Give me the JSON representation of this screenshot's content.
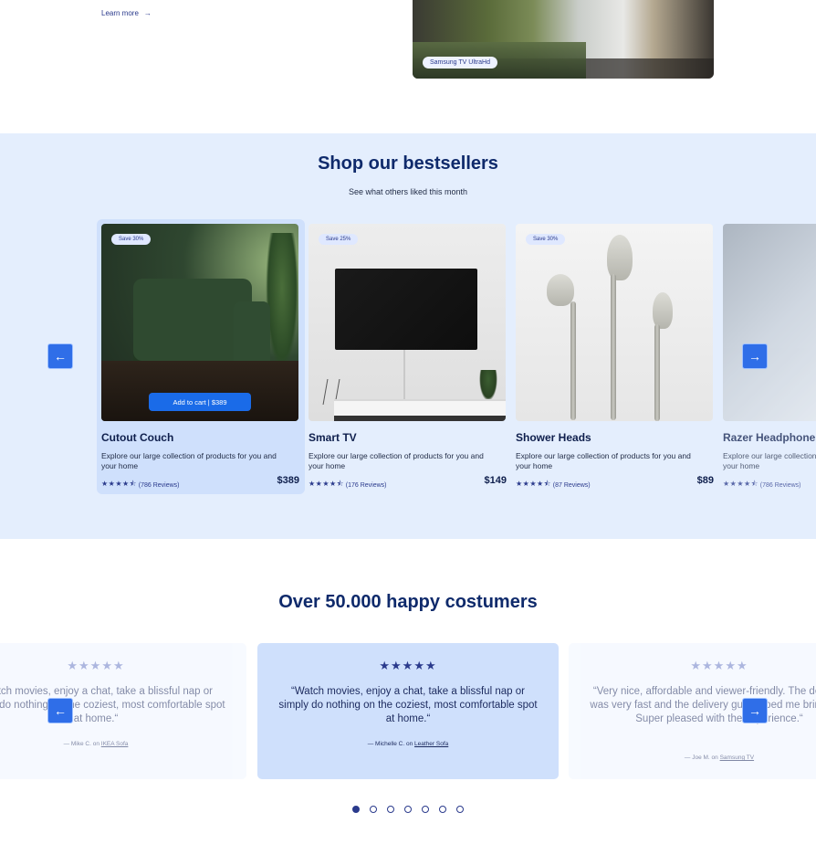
{
  "hero": {
    "learn_more": "Learn more",
    "image_tag": "Samsung TV UltraHd"
  },
  "bestsellers": {
    "title": "Shop our bestsellers",
    "subtitle": "See what others liked this month",
    "add_to_cart": "Add to cart | $389",
    "products": [
      {
        "badge": "Save 30%",
        "name": "Cutout Couch",
        "description": "Explore our large collection of products for you and your home",
        "rating": 4.5,
        "reviews": "(786 Reviews)",
        "price": "$389"
      },
      {
        "badge": "Save 25%",
        "name": "Smart TV",
        "description": "Explore our large collection of products for you and your home",
        "rating": 4.5,
        "reviews": "(176 Reviews)",
        "price": "$149"
      },
      {
        "badge": "Save 30%",
        "name": "Shower Heads",
        "description": "Explore our large collection of products for you and your home",
        "rating": 4.5,
        "reviews": "(87 Reviews)",
        "price": "$89"
      },
      {
        "badge": "",
        "name": "Razer Headphone",
        "description": "Explore our large collection of products for you and your home",
        "rating": 4.5,
        "reviews": "(786 Reviews)",
        "price": ""
      }
    ]
  },
  "testimonials": {
    "title": "Over 50.000 happy costumers",
    "reviews": [
      {
        "quote": "“Watch movies, enjoy a chat, take a blissful nap or simply do nothing on the coziest, most comfortable spot at home.“",
        "author": "— Mike C. on",
        "product": "IKEA Sofa"
      },
      {
        "quote": "“Watch movies, enjoy a chat, take a blissful nap or simply do nothing on the coziest, most comfortable spot at home.“",
        "author": "— Michelle C. on",
        "product": "Leather Sofa"
      },
      {
        "quote": "“Very nice, affordable and viewer-friendly. The delivery was very fast and the delivery guy helped me bring it in. Super pleased with the experience.“",
        "author": "— Joe M. on",
        "product": "Samsung TV"
      }
    ],
    "dots": 7,
    "active_dot": 0
  },
  "colors": {
    "accent": "#1a6be8",
    "navy": "#0f2a6b",
    "section_bg": "#e4eefd",
    "card_active": "#cfe0fc"
  },
  "icons": {
    "arrow_left": "arrow-left-icon",
    "arrow_right": "arrow-right-icon",
    "star": "star-icon"
  }
}
